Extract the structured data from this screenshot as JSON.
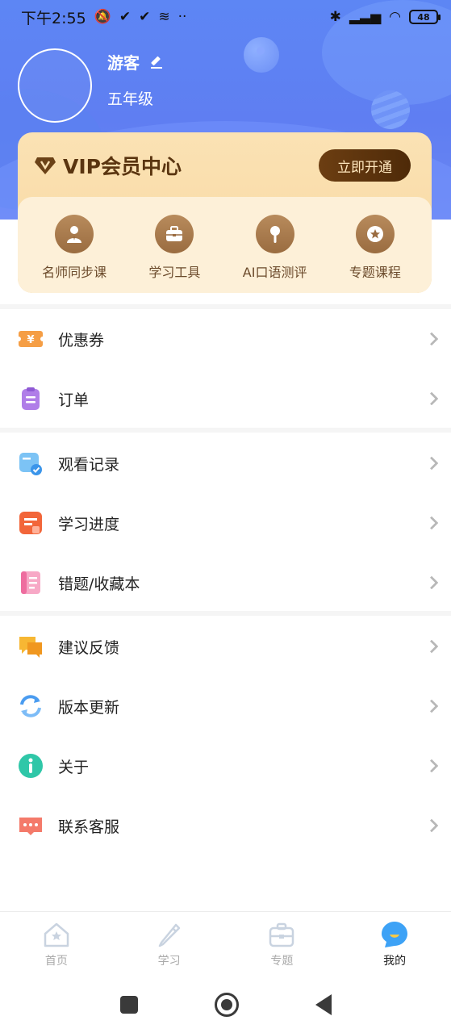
{
  "status_bar": {
    "time": "下午2:55",
    "battery": "48"
  },
  "profile": {
    "username": "游客",
    "grade": "五年级"
  },
  "vip": {
    "title": "VIP会员中心",
    "button_label": "立即开通",
    "items": [
      {
        "label": "名师同步课",
        "icon": "teacher-icon"
      },
      {
        "label": "学习工具",
        "icon": "toolbox-icon"
      },
      {
        "label": "AI口语测评",
        "icon": "microphone-icon"
      },
      {
        "label": "专题课程",
        "icon": "star-icon"
      }
    ]
  },
  "menu": {
    "group1": [
      {
        "label": "优惠券",
        "icon": "coupon-icon",
        "color": "#f5a04a"
      },
      {
        "label": "订单",
        "icon": "order-icon",
        "color": "#b07ee8"
      }
    ],
    "group2": [
      {
        "label": "观看记录",
        "icon": "history-icon",
        "color": "#4fa8f0"
      },
      {
        "label": "学习进度",
        "icon": "progress-icon",
        "color": "#f2663a"
      },
      {
        "label": "错题/收藏本",
        "icon": "notebook-icon",
        "color": "#f48fb1"
      }
    ],
    "group3": [
      {
        "label": "建议反馈",
        "icon": "feedback-icon",
        "color": "#f7b733"
      },
      {
        "label": "版本更新",
        "icon": "update-icon",
        "color": "#4a9cf0"
      },
      {
        "label": "关于",
        "icon": "info-icon",
        "color": "#2fc7a8"
      },
      {
        "label": "联系客服",
        "icon": "chat-icon",
        "color": "#f47a6a"
      }
    ]
  },
  "tabs": [
    {
      "label": "首页",
      "icon": "home-icon",
      "active": false
    },
    {
      "label": "学习",
      "icon": "pencil-icon",
      "active": false
    },
    {
      "label": "专题",
      "icon": "briefcase-icon",
      "active": false
    },
    {
      "label": "我的",
      "icon": "profile-bubble-icon",
      "active": true
    }
  ],
  "colors": {
    "header": "#5f7ef2",
    "vip_gold": "#f7d8a1",
    "vip_brown": "#5a3510",
    "active_tab": "#4fa3f5"
  }
}
